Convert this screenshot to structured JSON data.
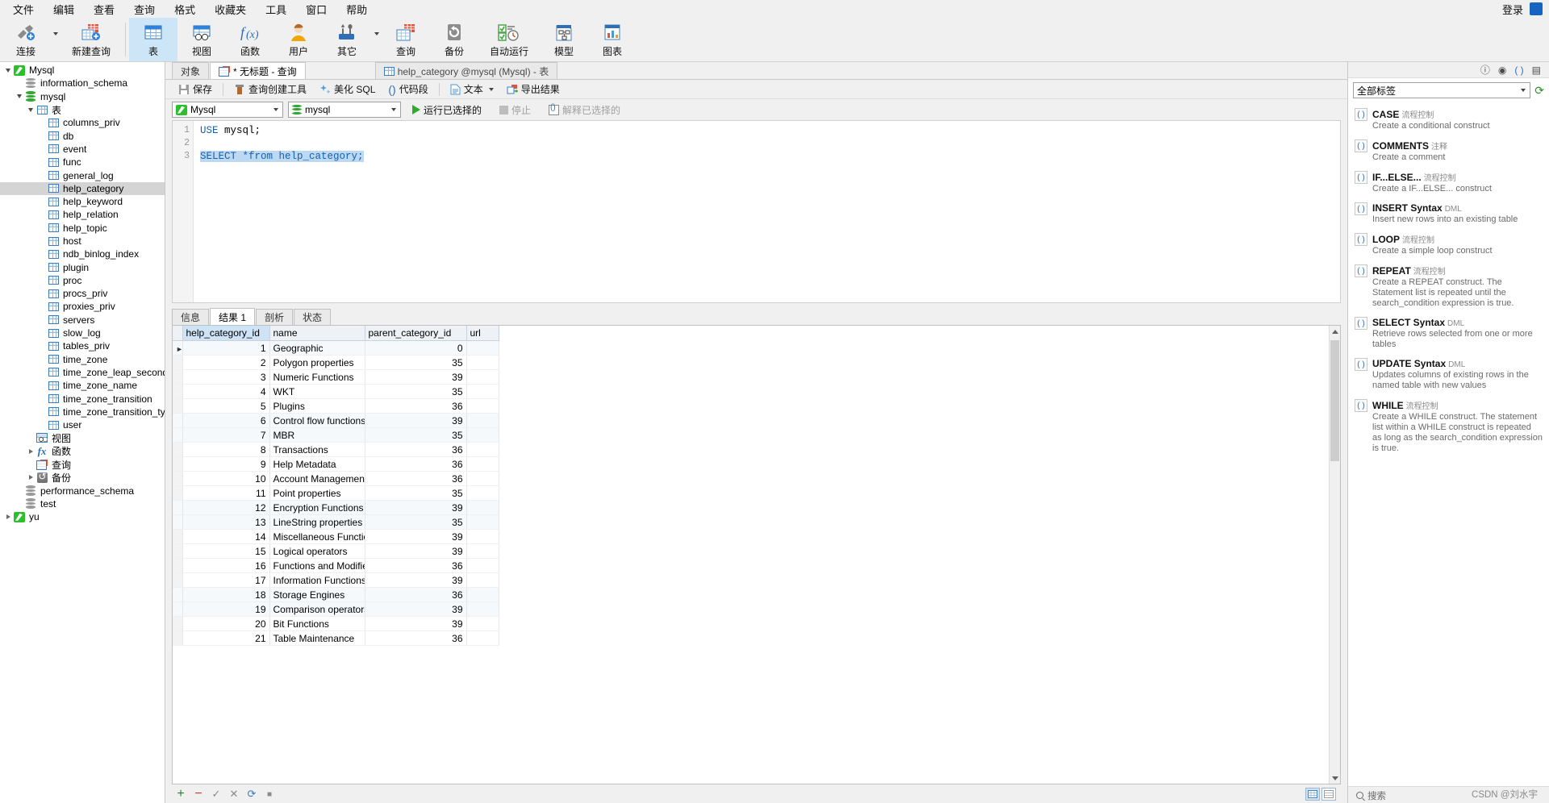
{
  "menubar": {
    "items": [
      {
        "label": "文件",
        "name": "menu-file"
      },
      {
        "label": "编辑",
        "name": "menu-edit"
      },
      {
        "label": "查看",
        "name": "menu-view"
      },
      {
        "label": "查询",
        "name": "menu-query"
      },
      {
        "label": "格式",
        "name": "menu-format"
      },
      {
        "label": "收藏夹",
        "name": "menu-favorites"
      },
      {
        "label": "工具",
        "name": "menu-tools"
      },
      {
        "label": "窗口",
        "name": "menu-window"
      },
      {
        "label": "帮助",
        "name": "menu-help"
      }
    ],
    "login_label": "登录"
  },
  "ribbon": {
    "items": [
      {
        "label": "连接",
        "icon": "connection-icon",
        "selected": false,
        "caret": true
      },
      {
        "label": "新建查询",
        "icon": "new-query-icon",
        "selected": false,
        "caret": false
      },
      {
        "label": "表",
        "icon": "table-icon",
        "selected": true,
        "caret": false
      },
      {
        "label": "视图",
        "icon": "view-icon",
        "selected": false,
        "caret": false
      },
      {
        "label": "函数",
        "icon": "function-icon",
        "selected": false,
        "caret": false
      },
      {
        "label": "用户",
        "icon": "user-icon",
        "selected": false,
        "caret": false
      },
      {
        "label": "其它",
        "icon": "other-tools-icon",
        "selected": false,
        "caret": true
      },
      {
        "label": "查询",
        "icon": "query-icon",
        "selected": false,
        "caret": false
      },
      {
        "label": "备份",
        "icon": "backup-icon",
        "selected": false,
        "caret": false
      },
      {
        "label": "自动运行",
        "icon": "automation-icon",
        "selected": false,
        "caret": false
      },
      {
        "label": "模型",
        "icon": "model-icon",
        "selected": false,
        "caret": false
      },
      {
        "label": "图表",
        "icon": "chart-icon",
        "selected": false,
        "caret": false
      }
    ]
  },
  "sidebar": {
    "nodes": [
      {
        "label": "Mysql",
        "indent": 0,
        "expander": "down",
        "icon": "connection-icon",
        "selected": false
      },
      {
        "label": "information_schema",
        "indent": 1,
        "expander": "none",
        "icon": "database-grey-icon",
        "selected": false
      },
      {
        "label": "mysql",
        "indent": 1,
        "expander": "down",
        "icon": "database-green-icon",
        "selected": false
      },
      {
        "label": "表",
        "indent": 2,
        "expander": "down",
        "icon": "table-icon",
        "selected": false
      },
      {
        "label": "columns_priv",
        "indent": 3,
        "expander": "none",
        "icon": "table-icon",
        "selected": false
      },
      {
        "label": "db",
        "indent": 3,
        "expander": "none",
        "icon": "table-icon",
        "selected": false
      },
      {
        "label": "event",
        "indent": 3,
        "expander": "none",
        "icon": "table-icon",
        "selected": false
      },
      {
        "label": "func",
        "indent": 3,
        "expander": "none",
        "icon": "table-icon",
        "selected": false
      },
      {
        "label": "general_log",
        "indent": 3,
        "expander": "none",
        "icon": "table-icon",
        "selected": false
      },
      {
        "label": "help_category",
        "indent": 3,
        "expander": "none",
        "icon": "table-icon",
        "selected": true
      },
      {
        "label": "help_keyword",
        "indent": 3,
        "expander": "none",
        "icon": "table-icon",
        "selected": false
      },
      {
        "label": "help_relation",
        "indent": 3,
        "expander": "none",
        "icon": "table-icon",
        "selected": false
      },
      {
        "label": "help_topic",
        "indent": 3,
        "expander": "none",
        "icon": "table-icon",
        "selected": false
      },
      {
        "label": "host",
        "indent": 3,
        "expander": "none",
        "icon": "table-icon",
        "selected": false
      },
      {
        "label": "ndb_binlog_index",
        "indent": 3,
        "expander": "none",
        "icon": "table-icon",
        "selected": false
      },
      {
        "label": "plugin",
        "indent": 3,
        "expander": "none",
        "icon": "table-icon",
        "selected": false
      },
      {
        "label": "proc",
        "indent": 3,
        "expander": "none",
        "icon": "table-icon",
        "selected": false
      },
      {
        "label": "procs_priv",
        "indent": 3,
        "expander": "none",
        "icon": "table-icon",
        "selected": false
      },
      {
        "label": "proxies_priv",
        "indent": 3,
        "expander": "none",
        "icon": "table-icon",
        "selected": false
      },
      {
        "label": "servers",
        "indent": 3,
        "expander": "none",
        "icon": "table-icon",
        "selected": false
      },
      {
        "label": "slow_log",
        "indent": 3,
        "expander": "none",
        "icon": "table-icon",
        "selected": false
      },
      {
        "label": "tables_priv",
        "indent": 3,
        "expander": "none",
        "icon": "table-icon",
        "selected": false
      },
      {
        "label": "time_zone",
        "indent": 3,
        "expander": "none",
        "icon": "table-icon",
        "selected": false
      },
      {
        "label": "time_zone_leap_second",
        "indent": 3,
        "expander": "none",
        "icon": "table-icon",
        "selected": false
      },
      {
        "label": "time_zone_name",
        "indent": 3,
        "expander": "none",
        "icon": "table-icon",
        "selected": false
      },
      {
        "label": "time_zone_transition",
        "indent": 3,
        "expander": "none",
        "icon": "table-icon",
        "selected": false
      },
      {
        "label": "time_zone_transition_type",
        "indent": 3,
        "expander": "none",
        "icon": "table-icon",
        "selected": false
      },
      {
        "label": "user",
        "indent": 3,
        "expander": "none",
        "icon": "table-icon",
        "selected": false
      },
      {
        "label": "视图",
        "indent": 2,
        "expander": "none",
        "icon": "view-icon",
        "selected": false
      },
      {
        "label": "函数",
        "indent": 2,
        "expander": "right",
        "icon": "function-icon",
        "selected": false
      },
      {
        "label": "查询",
        "indent": 2,
        "expander": "none",
        "icon": "query-icon",
        "selected": false
      },
      {
        "label": "备份",
        "indent": 2,
        "expander": "right",
        "icon": "backup-icon",
        "selected": false
      },
      {
        "label": "performance_schema",
        "indent": 1,
        "expander": "none",
        "icon": "database-grey-icon",
        "selected": false
      },
      {
        "label": "test",
        "indent": 1,
        "expander": "none",
        "icon": "database-grey-icon",
        "selected": false
      },
      {
        "label": "yu",
        "indent": 0,
        "expander": "right",
        "icon": "connection-icon",
        "selected": false
      }
    ]
  },
  "editor_tabs": {
    "object_tab": "对象",
    "query_tab": "* 无标题 - 查询",
    "table_tab": "help_category @mysql (Mysql) - 表"
  },
  "editor_toolbar": {
    "save": "保存",
    "query_builder": "查询创建工具",
    "beautify_sql": "美化 SQL",
    "code_snippet": "代码段",
    "text": "文本",
    "export_result": "导出结果"
  },
  "run_bar": {
    "connection": "Mysql",
    "database": "mysql",
    "run_selected": "运行已选择的",
    "stop": "停止",
    "explain_selected": "解释已选择的"
  },
  "sql": {
    "lines": [
      "1",
      "2",
      "3"
    ],
    "line1_kw": "USE",
    "line1_rest": " mysql;",
    "line3": "SELECT *from help_category;"
  },
  "result_tabs": [
    {
      "label": "信息",
      "active": false
    },
    {
      "label": "结果 1",
      "active": true
    },
    {
      "label": "剖析",
      "active": false
    },
    {
      "label": "状态",
      "active": false
    }
  ],
  "grid": {
    "columns": [
      "help_category_id",
      "name",
      "parent_category_id",
      "url"
    ],
    "rows": [
      [
        "1",
        "Geographic",
        "0",
        ""
      ],
      [
        "2",
        "Polygon properties",
        "35",
        ""
      ],
      [
        "3",
        "Numeric Functions",
        "39",
        ""
      ],
      [
        "4",
        "WKT",
        "35",
        ""
      ],
      [
        "5",
        "Plugins",
        "36",
        ""
      ],
      [
        "6",
        "Control flow functions",
        "39",
        ""
      ],
      [
        "7",
        "MBR",
        "35",
        ""
      ],
      [
        "8",
        "Transactions",
        "36",
        ""
      ],
      [
        "9",
        "Help Metadata",
        "36",
        ""
      ],
      [
        "10",
        "Account Management",
        "36",
        ""
      ],
      [
        "11",
        "Point properties",
        "35",
        ""
      ],
      [
        "12",
        "Encryption Functions",
        "39",
        ""
      ],
      [
        "13",
        "LineString properties",
        "35",
        ""
      ],
      [
        "14",
        "Miscellaneous Functions",
        "39",
        ""
      ],
      [
        "15",
        "Logical operators",
        "39",
        ""
      ],
      [
        "16",
        "Functions and Modifiers f",
        "36",
        ""
      ],
      [
        "17",
        "Information Functions",
        "39",
        ""
      ],
      [
        "18",
        "Storage Engines",
        "36",
        ""
      ],
      [
        "19",
        "Comparison operators",
        "39",
        ""
      ],
      [
        "20",
        "Bit Functions",
        "39",
        ""
      ],
      [
        "21",
        "Table Maintenance",
        "36",
        ""
      ]
    ]
  },
  "grid_toolbar": {
    "add": "+",
    "remove": "−",
    "confirm": "✓",
    "cancel": "✕",
    "refresh": "⟳",
    "stop": "■"
  },
  "right_panel": {
    "filter_value": "全部标签",
    "snippets": [
      {
        "title": "CASE",
        "tag": "流程控制",
        "desc": "Create a conditional construct"
      },
      {
        "title": "COMMENTS",
        "tag": "注释",
        "desc": "Create a comment"
      },
      {
        "title": "IF...ELSE...",
        "tag": "流程控制",
        "desc": "Create a IF...ELSE... construct"
      },
      {
        "title": "INSERT Syntax",
        "tag": "DML",
        "desc": "Insert new rows into an existing table"
      },
      {
        "title": "LOOP",
        "tag": "流程控制",
        "desc": "Create a simple loop construct"
      },
      {
        "title": "REPEAT",
        "tag": "流程控制",
        "desc": "Create a REPEAT construct. The Statement list is repeated until the search_condition expression is true."
      },
      {
        "title": "SELECT Syntax",
        "tag": "DML",
        "desc": "Retrieve rows selected from one or more tables"
      },
      {
        "title": "UPDATE Syntax",
        "tag": "DML",
        "desc": "Updates columns of existing rows in the named table with new values"
      },
      {
        "title": "WHILE",
        "tag": "流程控制",
        "desc": "Create a WHILE construct. The statement list within a WHILE construct is repeated as long as the search_condition expression is true."
      }
    ],
    "search_placeholder": "搜索"
  },
  "watermark": "CSDN @刘水宇"
}
